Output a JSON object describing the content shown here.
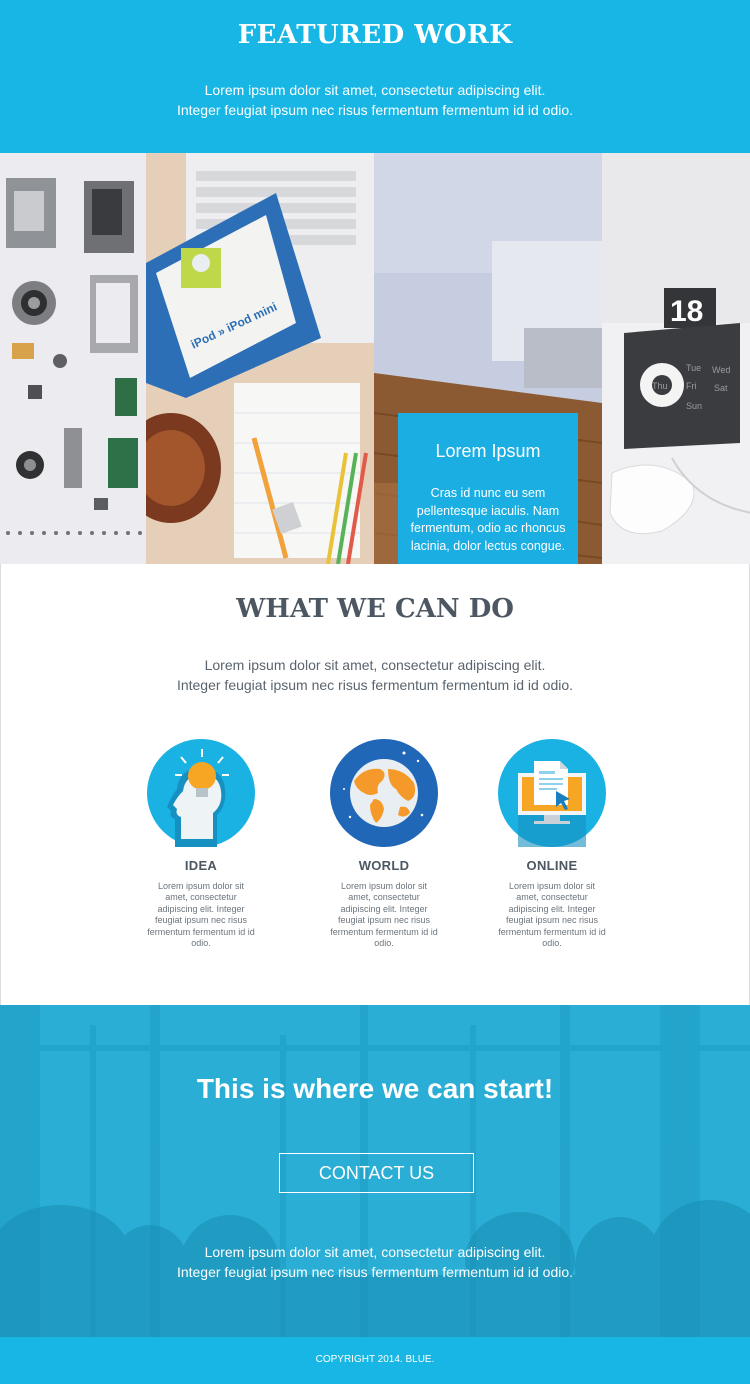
{
  "featured": {
    "title": "FEATURED WORK",
    "text_line1": "Lorem ipsum dolor sit amet, consectetur adipiscing elit.",
    "text_line2": "Integer feugiat ipsum nec risus fermentum fermentum id id odio.",
    "overlay_card": {
      "title": "Lorem Ipsum",
      "text": "Cras id nunc eu sem pellentesque iaculis. Nam fermentum, odio ac rhoncus lacinia, dolor lectus congue."
    },
    "photo_texts": {
      "ipod_book": "iPod » iPod mini",
      "calendar_number": "18",
      "calendar_days": [
        "Tue",
        "Wed",
        "Thu",
        "Fri",
        "Sat",
        "Sun"
      ]
    }
  },
  "services": {
    "title": "WHAT WE CAN DO",
    "text_line1": "Lorem ipsum dolor sit amet, consectetur adipiscing elit.",
    "text_line2": "Integer feugiat ipsum nec risus fermentum fermentum id id odio.",
    "items": [
      {
        "name": "IDEA",
        "icon": "lightbulb-head-icon",
        "description": "Lorem ipsum dolor sit amet, consectetur adipiscing elit. Integer feugiat ipsum nec risus fermentum fermentum id id odio."
      },
      {
        "name": "WORLD",
        "icon": "globe-icon",
        "description": "Lorem ipsum dolor sit amet, consectetur adipiscing elit. Integer feugiat ipsum nec risus fermentum fermentum id id odio."
      },
      {
        "name": "ONLINE",
        "icon": "monitor-document-icon",
        "description": "Lorem ipsum dolor sit amet, consectetur adipiscing elit. Integer feugiat ipsum nec risus fermentum fermentum id id odio."
      }
    ]
  },
  "cta": {
    "title": "This is where we can start!",
    "button_label": "CONTACT US",
    "text_line1": "Lorem ipsum dolor sit amet, consectetur adipiscing elit.",
    "text_line2": "Integer feugiat ipsum nec risus fermentum fermentum id id odio."
  },
  "footer": {
    "copyright": "COPYRIGHT 2014. BLUE."
  },
  "colors": {
    "brand_blue": "#18b6e4",
    "card_blue": "#1aaee3",
    "cta_blue": "#2aaed5",
    "heading_gray": "#4d5762",
    "icon_circle": "#1ab2e3",
    "globe_circle": "#2067b8",
    "bulb_orange": "#f6a623"
  }
}
